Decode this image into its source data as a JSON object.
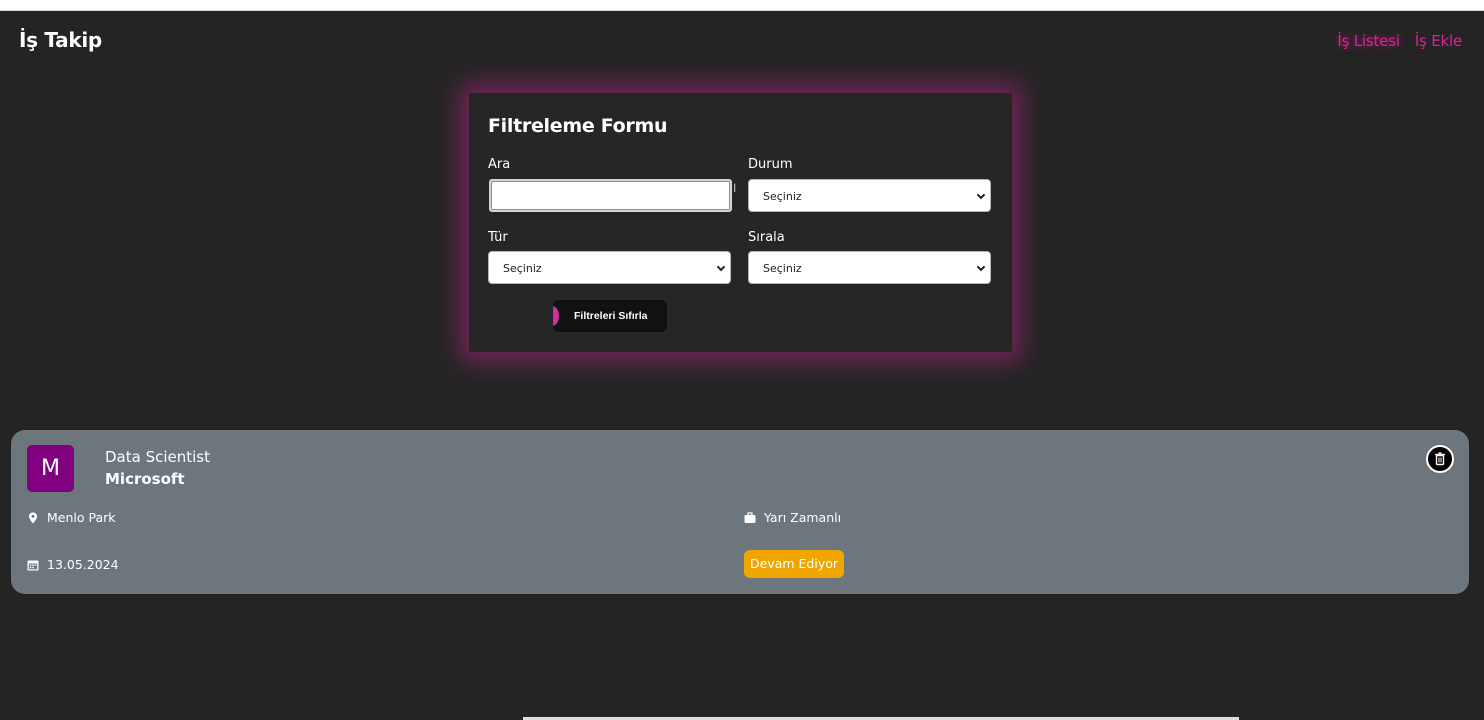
{
  "header": {
    "brand": "İş Takip",
    "nav": [
      {
        "label": "İş Listesi",
        "active": true
      },
      {
        "label": "İş Ekle",
        "active": false
      }
    ]
  },
  "filter_form": {
    "title": "Filtreleme Formu",
    "search": {
      "label": "Ara",
      "value": ""
    },
    "status": {
      "label": "Durum",
      "selected": "Seçiniz"
    },
    "type": {
      "label": "Tür",
      "selected": "Seçiniz"
    },
    "sort": {
      "label": "Sırala",
      "selected": "Seçiniz"
    },
    "reset_button": "Filtreleri Sıfırla"
  },
  "jobs": [
    {
      "avatar_letter": "M",
      "position": "Data Scientist",
      "company": "Microsoft",
      "location": "Menlo Park",
      "job_type": "Yarı Zamanlı",
      "date": "13.05.2024",
      "status": "Devam Ediyor"
    }
  ],
  "colors": {
    "background": "#242424",
    "accent": "#e0219a",
    "card": "#6d757d",
    "avatar": "#800080",
    "status_badge": "#f0a500",
    "glow": "#be288c"
  },
  "icons": {
    "location": "map-pin-icon",
    "job_type": "briefcase-icon",
    "date": "calendar-icon",
    "delete": "trash-icon"
  }
}
